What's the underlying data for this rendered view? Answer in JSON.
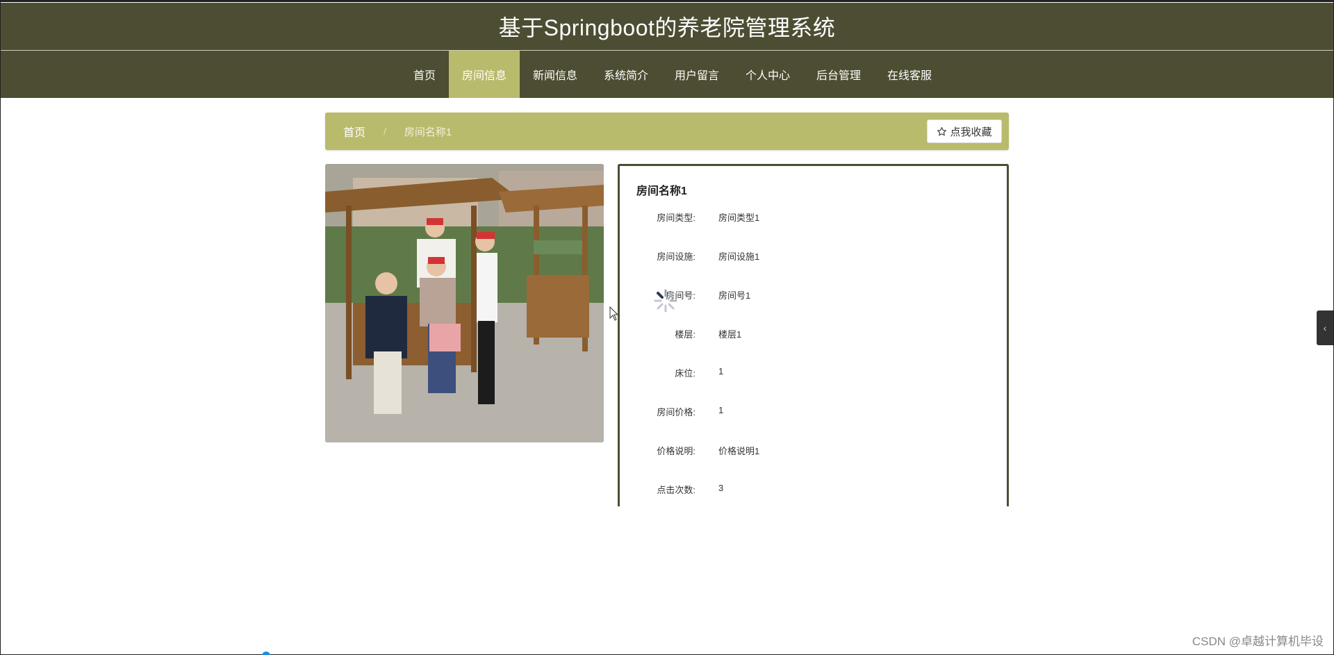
{
  "header": {
    "title": "基于Springboot的养老院管理系统"
  },
  "nav": {
    "items": [
      {
        "label": "首页",
        "active": false
      },
      {
        "label": "房间信息",
        "active": true
      },
      {
        "label": "新闻信息",
        "active": false
      },
      {
        "label": "系统简介",
        "active": false
      },
      {
        "label": "用户留言",
        "active": false
      },
      {
        "label": "个人中心",
        "active": false
      },
      {
        "label": "后台管理",
        "active": false
      },
      {
        "label": "在线客服",
        "active": false
      }
    ]
  },
  "breadcrumb": {
    "home": "首页",
    "separator": "/",
    "current": "房间名称1"
  },
  "favorite_button": {
    "label": "点我收藏",
    "icon": "star-icon"
  },
  "detail": {
    "title": "房间名称1",
    "fields": [
      {
        "label": "房间类型:",
        "value": "房间类型1"
      },
      {
        "label": "房间设施:",
        "value": "房间设施1"
      },
      {
        "label": "房间号:",
        "value": "房间号1"
      },
      {
        "label": "楼层:",
        "value": "楼层1"
      },
      {
        "label": "床位:",
        "value": "1"
      },
      {
        "label": "房间价格:",
        "value": "1"
      },
      {
        "label": "价格说明:",
        "value": "价格说明1"
      },
      {
        "label": "点击次数:",
        "value": "3"
      }
    ]
  },
  "side_toggle": {
    "label": "‹"
  },
  "watermark": "CSDN @卓越计算机毕设",
  "colors": {
    "header_bg": "#4d4d33",
    "accent": "#b9bb6c",
    "border": "#4d4d33"
  }
}
